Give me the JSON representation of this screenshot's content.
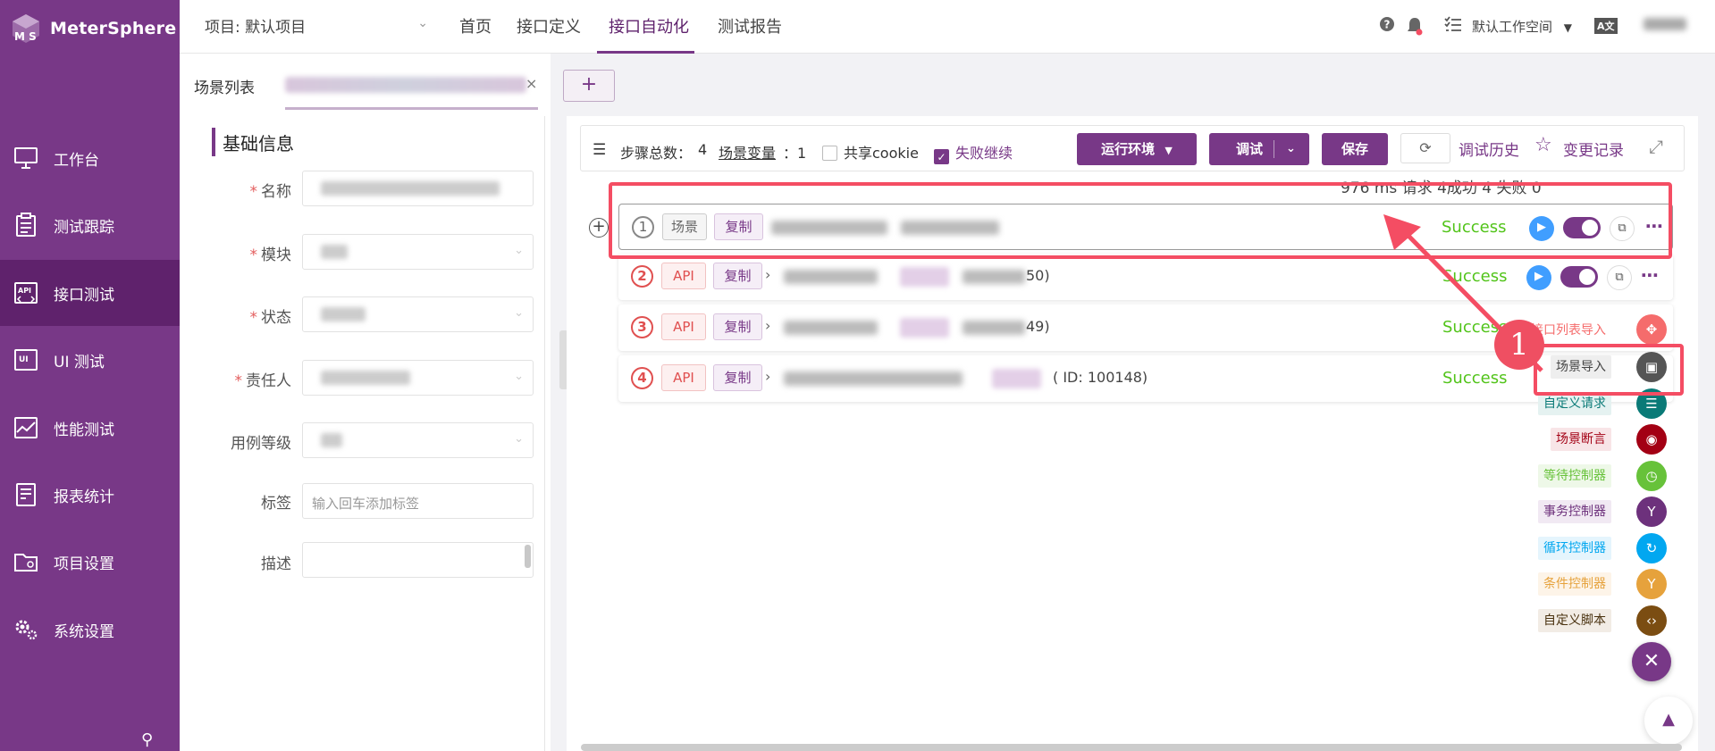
{
  "app": {
    "name": "MeterSphere"
  },
  "sidebar": {
    "items": [
      {
        "label": "工作台",
        "icon": "monitor-icon"
      },
      {
        "label": "测试跟踪",
        "icon": "clipboard-icon"
      },
      {
        "label": "接口测试",
        "icon": "api-icon",
        "active": true
      },
      {
        "label": "UI 测试",
        "icon": "ui-icon"
      },
      {
        "label": "性能测试",
        "icon": "performance-icon"
      },
      {
        "label": "报表统计",
        "icon": "report-icon"
      },
      {
        "label": "项目设置",
        "icon": "folder-icon"
      },
      {
        "label": "系统设置",
        "icon": "gear-icon"
      }
    ]
  },
  "header": {
    "project": "项目: 默认项目",
    "tabs": [
      "首页",
      "接口定义",
      "接口自动化",
      "测试报告"
    ],
    "active_tab": "接口自动化",
    "workspace": "默认工作空间",
    "lang_icon": "A文"
  },
  "scenario_list": {
    "title": "场景列表",
    "add_label": "+"
  },
  "basic_info": {
    "title": "基础信息",
    "fields": {
      "name": "名称",
      "module": "模块",
      "status": "状态",
      "owner": "责任人",
      "level": "用例等级",
      "tags": "标签",
      "tags_placeholder": "输入回车添加标签",
      "desc": "描述"
    }
  },
  "toolbar": {
    "step_total_label": "步骤总数：",
    "step_total": "4",
    "variables_label": "场景变量",
    "variables_count": "：1",
    "share_cookie": "共享cookie",
    "continue_on_fail": "失败继续",
    "env_button": "运行环境",
    "debug_button": "调试",
    "save_button": "保存",
    "history": "调试历史",
    "changes": "变更记录"
  },
  "summary": "976 ms 请求 4成功 4 失败 0",
  "steps": [
    {
      "index": "1",
      "type": "场景",
      "copy": "复制",
      "status": "Success"
    },
    {
      "index": "2",
      "type": "API",
      "copy": "复制",
      "id_suffix": "50)",
      "status": "Success"
    },
    {
      "index": "3",
      "type": "API",
      "copy": "复制",
      "id_suffix": "49)",
      "status": "Success"
    },
    {
      "index": "4",
      "type": "API",
      "copy": "复制",
      "id_suffix": "( ID: 100148)",
      "status": "Success"
    }
  ],
  "float_menu": {
    "items": [
      {
        "label": "接口列表导入",
        "icon": "import-list-icon",
        "color": "#f56c6c"
      },
      {
        "label": "场景导入",
        "icon": "scene-import-icon",
        "color": "#555555"
      },
      {
        "label": "自定义请求",
        "icon": "custom-request-icon",
        "color": "#0a7a77"
      },
      {
        "label": "场景断言",
        "icon": "assertion-icon",
        "color": "#a30014"
      },
      {
        "label": "等待控制器",
        "icon": "wait-icon",
        "color": "#67c23a"
      },
      {
        "label": "事务控制器",
        "icon": "transaction-icon",
        "color": "#6d317c"
      },
      {
        "label": "循环控制器",
        "icon": "loop-icon",
        "color": "#02a7f0"
      },
      {
        "label": "条件控制器",
        "icon": "condition-icon",
        "color": "#e6a23c"
      },
      {
        "label": "自定义脚本",
        "icon": "script-icon",
        "color": "#7b4d12"
      }
    ]
  },
  "annotation": {
    "badge": "1"
  }
}
